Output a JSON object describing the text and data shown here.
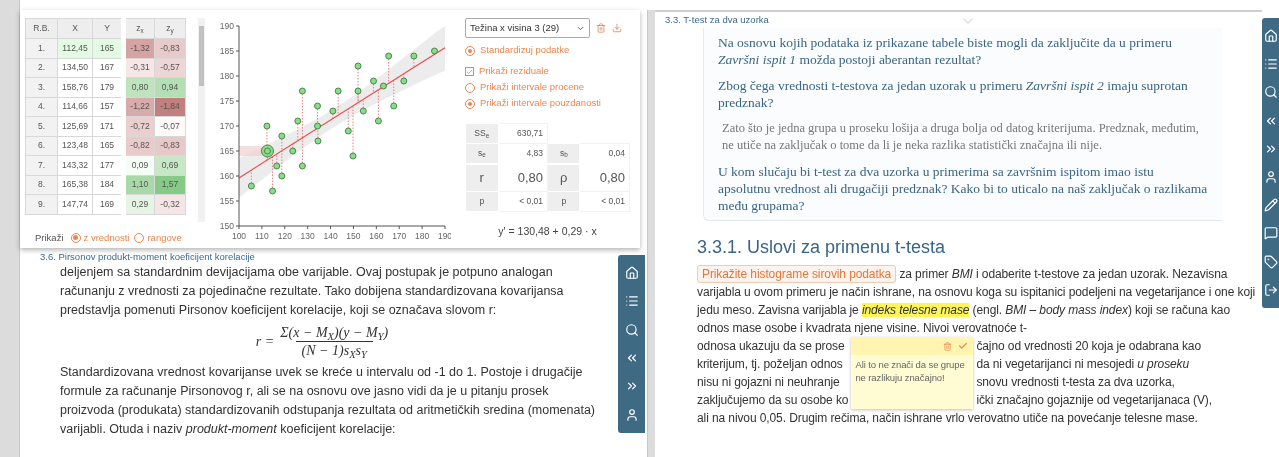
{
  "left_panel": {
    "data_card": {
      "table": {
        "columns": [
          "R.B.",
          "X",
          "Y",
          "z$_{x}$",
          "z$_{y}$"
        ],
        "rows": [
          {
            "selected": true,
            "cells": [
              "1.",
              "112,45",
              "165"
            ],
            "z": [
              {
                "value": "-1,32",
                "color": "#d6a3a3"
              },
              {
                "value": "-0,83",
                "color": "#e9caca"
              }
            ]
          },
          {
            "selected": false,
            "cells": [
              "2.",
              "134,50",
              "167"
            ],
            "z": [
              {
                "value": "-0,31",
                "color": "#f6e6e6"
              },
              {
                "value": "-0,57",
                "color": "#efd6d6"
              }
            ]
          },
          {
            "selected": false,
            "cells": [
              "3.",
              "158,76",
              "179"
            ],
            "z": [
              {
                "value": "0,80",
                "color": "#bfe3bf"
              },
              {
                "value": "0,94",
                "color": "#b4deb4"
              }
            ]
          },
          {
            "selected": false,
            "cells": [
              "4.",
              "114,66",
              "157"
            ],
            "z": [
              {
                "value": "-1,22",
                "color": "#d8aaaa"
              },
              {
                "value": "-1,84",
                "color": "#c27f7f"
              }
            ]
          },
          {
            "selected": false,
            "cells": [
              "5.",
              "125,69",
              "171"
            ],
            "z": [
              {
                "value": "-0,72",
                "color": "#ebcfcf"
              },
              {
                "value": "-0,07",
                "color": "#fefafa"
              }
            ]
          },
          {
            "selected": false,
            "cells": [
              "6.",
              "123,48",
              "165"
            ],
            "z": [
              {
                "value": "-0,82",
                "color": "#e9cbcb"
              },
              {
                "value": "-0,83",
                "color": "#e8c9c9"
              }
            ]
          },
          {
            "selected": false,
            "cells": [
              "7.",
              "143,32",
              "177"
            ],
            "z": [
              {
                "value": "0,09",
                "color": "#f6fcf6"
              },
              {
                "value": "0,69",
                "color": "#c7e7c7"
              }
            ]
          },
          {
            "selected": false,
            "cells": [
              "8.",
              "165,38",
              "184"
            ],
            "z": [
              {
                "value": "1,10",
                "color": "#a9d9a9"
              },
              {
                "value": "1,57",
                "color": "#87c987"
              }
            ]
          },
          {
            "selected": false,
            "cells": [
              "9.",
              "147,74",
              "169"
            ],
            "z": [
              {
                "value": "0,29",
                "color": "#e6f4e6"
              },
              {
                "value": "-0,32",
                "color": "#f5e5e5"
              }
            ]
          }
        ]
      },
      "display_label": "Prikaži",
      "display_options": [
        {
          "label": "z vrednosti",
          "selected": true
        },
        {
          "label": "rangove",
          "selected": false
        }
      ],
      "chart_data": {
        "type": "scatter",
        "x": [
          105.4,
          112.2,
          112.45,
          114.66,
          116.5,
          118.7,
          118.7,
          123.48,
          125.69,
          127.7,
          127.7,
          134.3,
          134.3,
          134.5,
          141,
          143.32,
          147.74,
          149.8,
          152,
          152,
          154.3,
          158.76,
          160.9,
          163.1,
          165.38,
          167.6,
          172,
          176.4,
          185.4
        ],
        "series": [
          {
            "color": "#86df86",
            "values": [
              158,
              170,
              165,
              157,
              162,
              168,
              160,
              165,
              171,
              177,
              162,
              174,
              170,
              167,
              173,
              177,
              169,
              164,
              182,
              177,
              173,
              179,
              171,
              178,
              184,
              174,
              179,
              184,
              185
            ]
          }
        ],
        "xlim": [
          100,
          190
        ],
        "ylim": [
          150,
          190
        ],
        "xticks": [
          100,
          110,
          120,
          130,
          140,
          150,
          160,
          170,
          180,
          190
        ],
        "yticks": [
          150,
          155,
          160,
          165,
          170,
          175,
          180,
          185,
          190
        ]
      },
      "dataset_select": {
        "value": "Težina x visina 3 (29)"
      },
      "options": [
        {
          "kind": "radio",
          "label": "Standardizuj podatke",
          "checked": true
        },
        {
          "kind": "checkbox",
          "label": "Prikaži reziduale",
          "checked": true
        },
        {
          "kind": "radio",
          "label": "Prikaži intervale procene",
          "checked": false
        },
        {
          "kind": "radio",
          "label": "Prikaži intervale pouzdanosti",
          "checked": true
        }
      ],
      "stats_rows": [
        {
          "kind": "small",
          "cells": [
            {
              "label": "SS$_{e}$",
              "value": "630,71"
            }
          ]
        },
        {
          "kind": "small",
          "cells": [
            {
              "label": "s$_{e}$",
              "value": "4,83"
            },
            {
              "label": "s$_{b}$",
              "value": "0,04"
            }
          ]
        },
        {
          "kind": "large",
          "cells": [
            {
              "label": "r",
              "value": "0,80"
            },
            {
              "label": "ρ",
              "value": "0,80"
            }
          ]
        },
        {
          "kind": "small",
          "cells": [
            {
              "label": "p",
              "value": "< 0,01"
            },
            {
              "label": "p",
              "value": "< 0,01"
            }
          ]
        }
      ],
      "equation": "y' = 130,48 + 0,29 · x"
    },
    "breadcrumb": "3.6. Pirsonov produkt-moment koeficijent korelacije",
    "paragraph_1": "deljenjem sa standardnim devijacijama obe varijable. Ovaj postupak je potpuno analogan računanju z vrednosti za pojedinačne rezultate. Tako dobijena standardizovana kovarijansa predstavlja pomenuti Pirsonov koeficijent korelacije, koji se označava slovom r:",
    "formula": {
      "lhs": "r =",
      "numerator": "Σ(x − M$_{X}$)(y − M$_{Y}$)",
      "denominator": "(N − 1)s$_{X}$s$_{Y}$"
    },
    "paragraph_2": "Standardizovana vrednost kovarijanse uvek se kreće u intervalu od -1 do 1. Postoje i drugačije formule za računanje Pirsonovog r, ali se na osnovu ove jasno vidi da je u pitanju prosek proizvoda (produkata) standardizovanih odstupanja rezultata od aritmetičkih sredina (momenata) varijabli. Otuda i naziv *produkt-moment* koeficijent korelacije:"
  },
  "right_panel": {
    "breadcrumb": "3.3. T-test za dva uzorka",
    "question_box": [
      {
        "kind": "question",
        "text": "Na osnovu kojih podataka iz prikazane tabele biste mogli da zaključite da u primeru *Završni ispit 1* možda postoji aberantan rezultat?"
      },
      {
        "kind": "question",
        "text": "Zbog čega vrednosti t-testova za jedan uzorak u primeru *Završni ispit 2* imaju suprotan predznak?"
      },
      {
        "kind": "answer",
        "text": "Zato što je jedna grupa u proseku lošija a druga bolja od datog kriterijuma. Predznak, međutim, ne utiče na zaključak o tome da li je neka razlika statistički značajna ili nije."
      },
      {
        "kind": "question",
        "text": "U kom slučaju bi t-test za dva uzorka u primerima sa završnim ispitom imao istu apsolutnu vrednost ali drugačiji predznak? Kako bi to uticalo na naš zaključak o razlikama među grupama?"
      }
    ],
    "heading": "3.3.1. Uslovi za primenu t-testa",
    "paragraph": [
      {
        "kind": "button",
        "text": "Prikažite histograme sirovih podatka"
      },
      {
        "kind": "text",
        "text": " za primer *BMI* i odaberite t-testove za jedan uzorak. Nezavisna varijabla u ovom primeru je način ishrane, na osnovu koga su ispitanici podeljeni na vegetarijance i one koji jedu meso. Zavisna varijabla je "
      },
      {
        "kind": "highlight",
        "text": "indeks telesne mase"
      },
      {
        "kind": "text",
        "text": " (engl. *BMI – body mass index*) koji se računa kao odnos mase osobe i kvadrata njene visine. Nivoi verovatnoće t-"
      }
    ],
    "covered_lines": [
      {
        "left": "odnosa ukazuju da se prose",
        "right": "čajno od vrednosti 20 koja je odabrana kao"
      },
      {
        "left": "kriterijum, tj. poželjan odnos",
        "right": "da ni vegetarijanci ni mesojedi *u proseku*"
      },
      {
        "left": "nisu ni gojazni ni neuhranje",
        "right": "snovu vrednosti t-testa za dva uzorka,"
      },
      {
        "left": "zaključujemo da su osobe ko",
        "right": "ički značajno gojaznije od vegetarijanaca (V),"
      }
    ],
    "last_line": "ali na nivou 0,05. Drugim rečima, način ishrane vrlo verovatno utiče na povećanje telesne mase.",
    "note": {
      "text": "Ali to ne znači da se grupe ne razlikuju značajno!"
    }
  }
}
